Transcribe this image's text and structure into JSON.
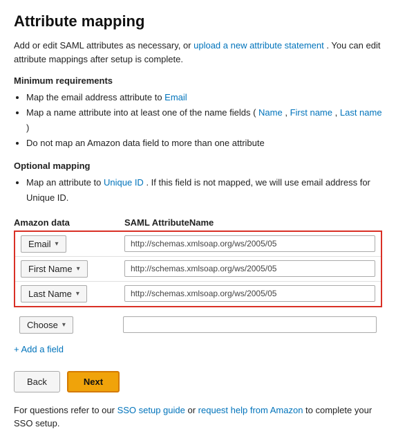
{
  "page": {
    "title": "Attribute mapping",
    "intro": {
      "text1": "Add or edit SAML attributes as necessary, or ",
      "link1": "upload a new attribute statement",
      "text2": ". You can edit attribute mappings after setup is complete."
    },
    "minimum_requirements": {
      "label": "Minimum requirements",
      "items": [
        {
          "text": "Map the email address attribute to ",
          "link": "Email"
        },
        {
          "text": "Map a name attribute into at least one of the name fields (",
          "links": [
            "Name",
            "First name",
            "Last name"
          ],
          "suffix": ")"
        },
        {
          "text": "Do not map an Amazon data field to more than one attribute",
          "link": null
        }
      ]
    },
    "optional_mapping": {
      "label": "Optional mapping",
      "items": [
        {
          "text1": "Map an attribute to ",
          "link1": "Unique ID",
          "text2": ". If this field is not mapped, we will use email address for Unique ID."
        }
      ]
    },
    "columns": {
      "amazon": "Amazon data",
      "saml": "SAML AttributeName"
    },
    "highlighted_rows": [
      {
        "field_label": "Email",
        "field_chevron": "▾",
        "saml_value": "http://schemas.xmlsoap.org/ws/2005/05"
      },
      {
        "field_label": "First Name",
        "field_chevron": "▾",
        "saml_value": "http://schemas.xmlsoap.org/ws/2005/05"
      },
      {
        "field_label": "Last Name",
        "field_chevron": "▾",
        "saml_value": "http://schemas.xmlsoap.org/ws/2005/05"
      }
    ],
    "choose_row": {
      "button_label": "Choose",
      "chevron": "▾",
      "saml_placeholder": ""
    },
    "add_field_label": "+ Add a field",
    "buttons": {
      "back": "Back",
      "next": "Next"
    },
    "footer": {
      "text1": "For questions refer to our ",
      "link1": "SSO setup guide",
      "text2": " or ",
      "link2": "request help from Amazon",
      "text3": " to complete your SSO setup."
    }
  }
}
